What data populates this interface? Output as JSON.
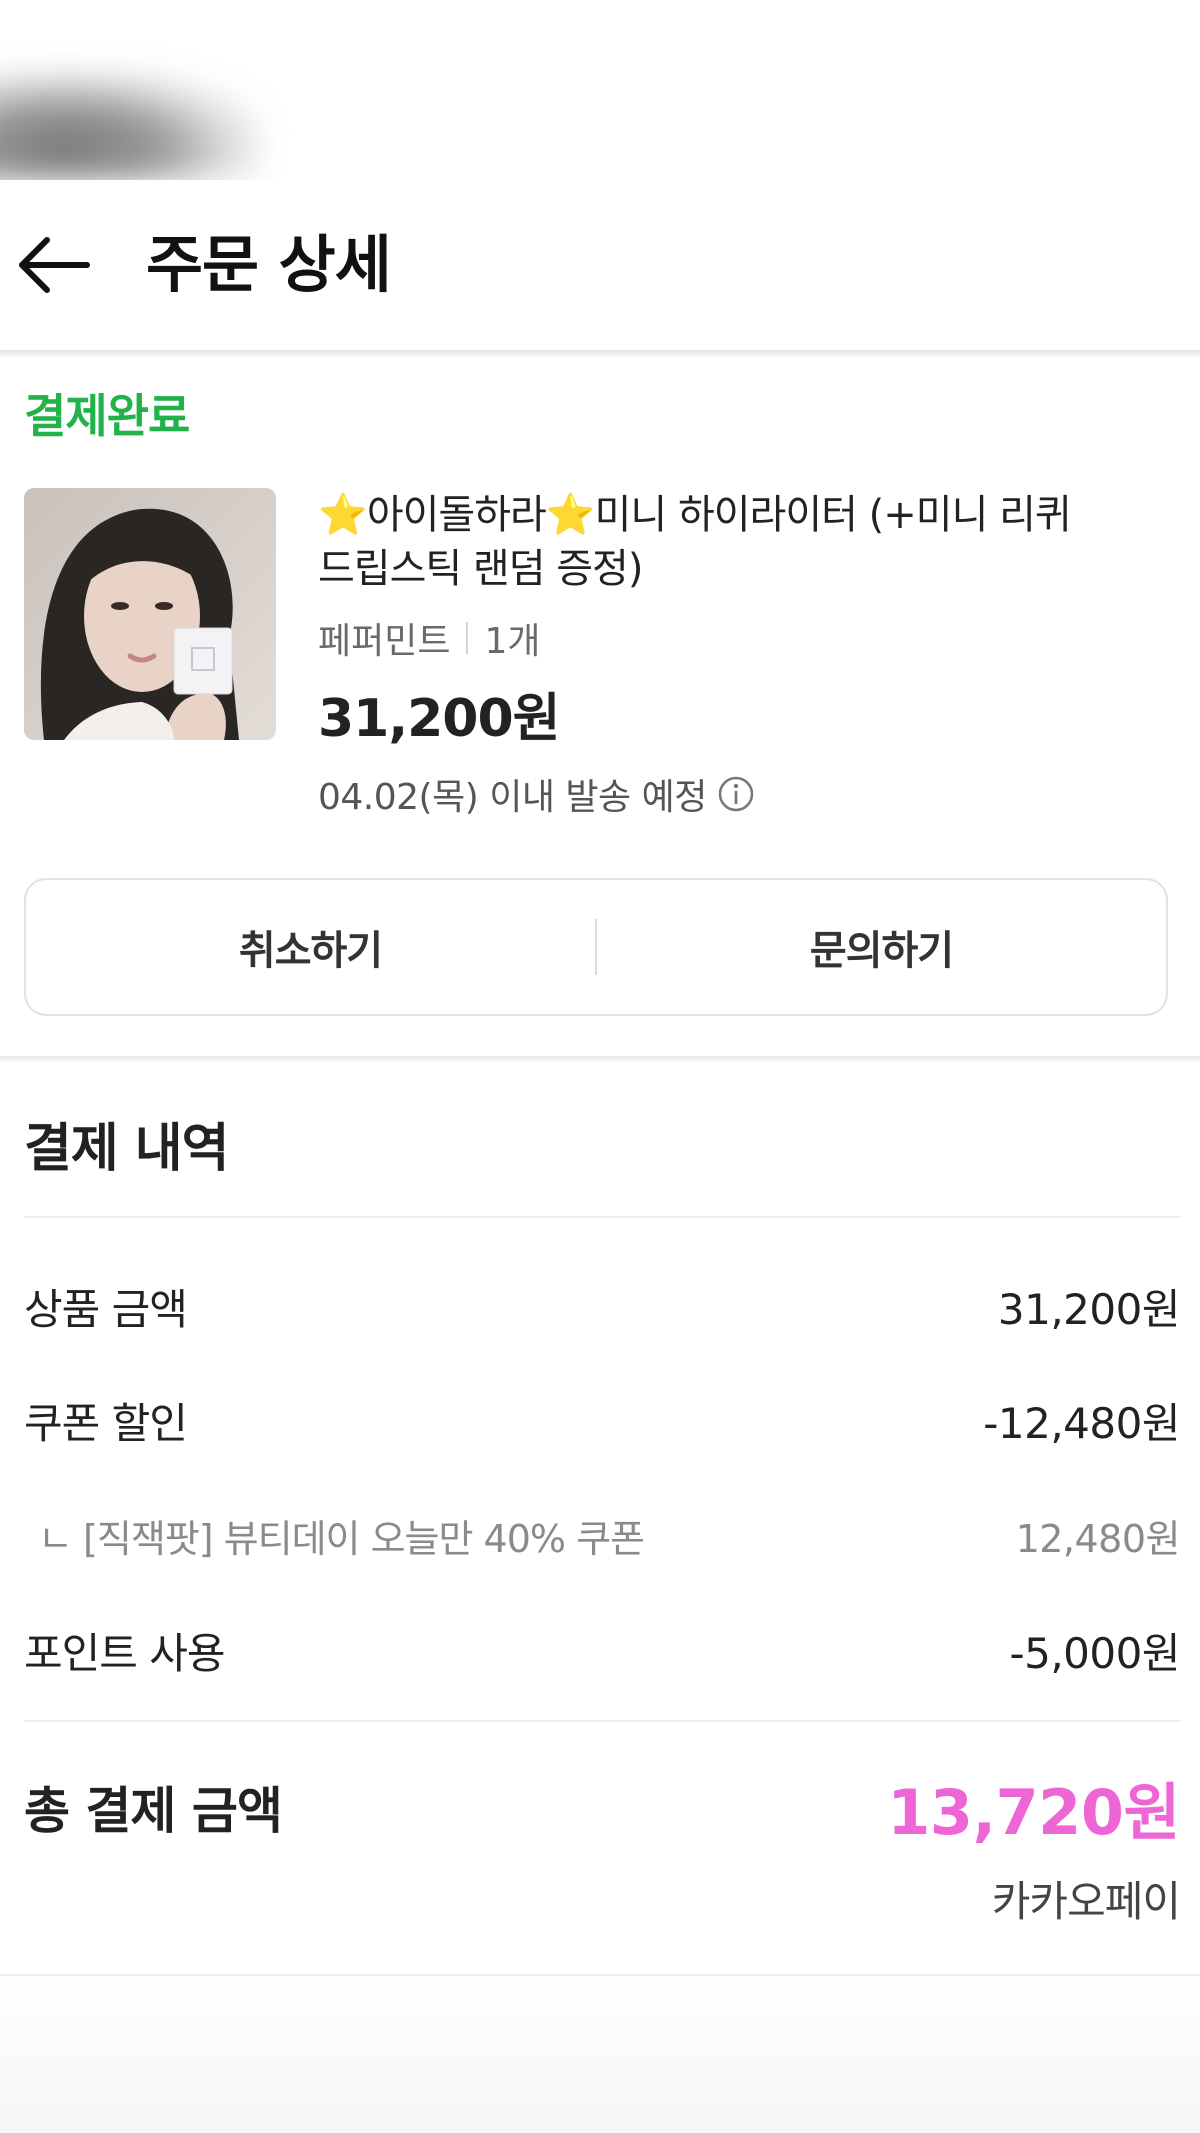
{
  "header": {
    "title": "주문 상세",
    "back_icon": "arrow-left-icon"
  },
  "order": {
    "status": "결제완료",
    "product": {
      "name_line1_part1": "아이돌하라",
      "name_line1_part2": "미니 하이라이터 (+미니 리퀴",
      "name_line2": "드립스틱 랜덤 증정)",
      "star": "⭐",
      "option": "페퍼민트",
      "quantity": "1개",
      "price": "31,200원",
      "shipping": "04.02(목) 이내 발송 예정"
    },
    "actions": {
      "cancel_label": "취소하기",
      "inquiry_label": "문의하기"
    }
  },
  "payment": {
    "title": "결제 내역",
    "product_amount_label": "상품 금액",
    "product_amount_value": "31,200원",
    "coupon_label": "쿠폰 할인",
    "coupon_value": "-12,480원",
    "coupon_detail_label": "ㄴ [직잭팟] 뷰티데이 오늘만 40% 쿠폰",
    "coupon_detail_value": "12,480원",
    "point_label": "포인트 사용",
    "point_value": "-5,000원",
    "total_label": "총 결제 금액",
    "total_value": "13,720원",
    "method": "카카오페이"
  },
  "colors": {
    "status_green": "#21b24a",
    "total_pink": "#ee66d6"
  }
}
